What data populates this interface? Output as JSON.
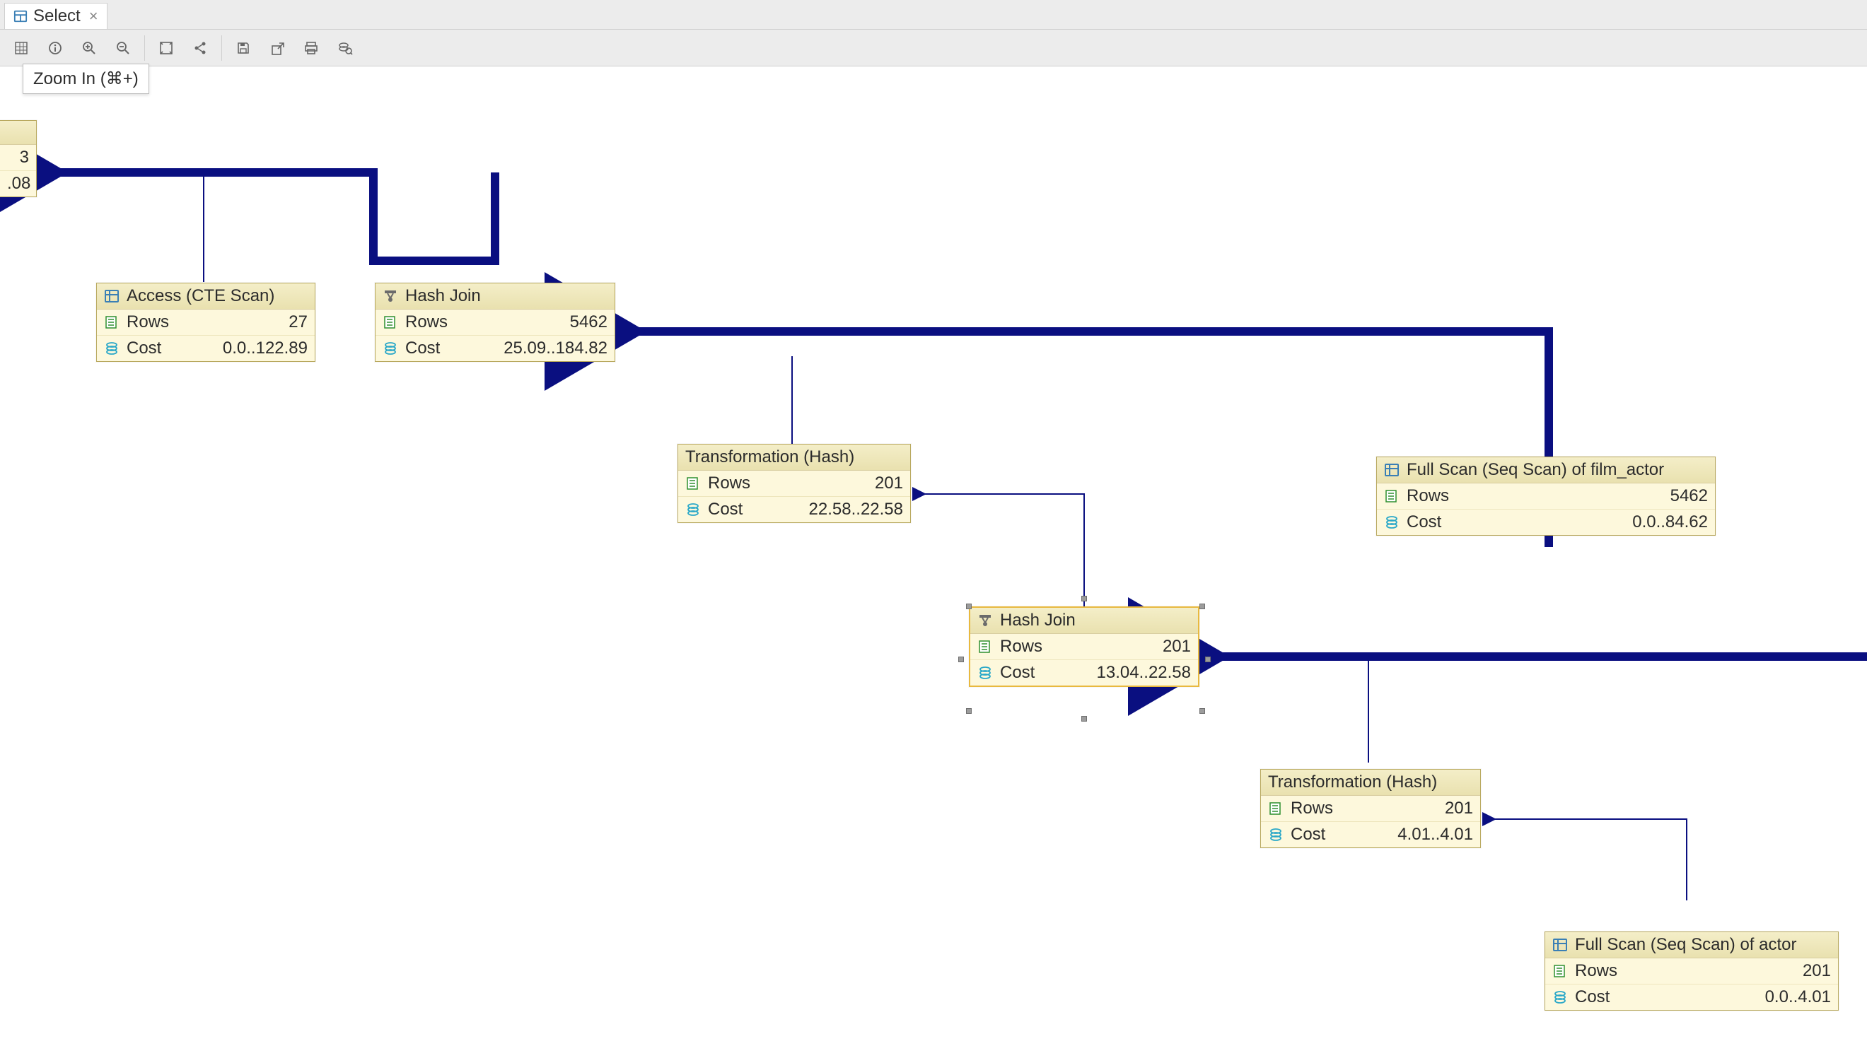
{
  "tab": {
    "label": "Select"
  },
  "tooltip": {
    "text": "Zoom In (⌘+)"
  },
  "toolbar_icons": [
    "grid-icon",
    "info-icon",
    "zoom-in-icon",
    "zoom-out-icon",
    "fit-to-screen-icon",
    "share-icon",
    "save-icon",
    "export-icon",
    "print-icon",
    "inspect-icon"
  ],
  "nodes": {
    "result_partial": {
      "rows": "3",
      "cost": ".08"
    },
    "access_cte": {
      "title": "Access (CTE Scan)",
      "rows_label": "Rows",
      "rows": "27",
      "cost_label": "Cost",
      "cost": "0.0..122.89"
    },
    "hash_join_1": {
      "title": "Hash Join",
      "rows_label": "Rows",
      "rows": "5462",
      "cost_label": "Cost",
      "cost": "25.09..184.82"
    },
    "transform_hash_1": {
      "title": "Transformation (Hash)",
      "rows_label": "Rows",
      "rows": "201",
      "cost_label": "Cost",
      "cost": "22.58..22.58"
    },
    "full_scan_film_actor": {
      "title": "Full Scan (Seq Scan) of film_actor",
      "rows_label": "Rows",
      "rows": "5462",
      "cost_label": "Cost",
      "cost": "0.0..84.62"
    },
    "hash_join_2": {
      "title": "Hash Join",
      "rows_label": "Rows",
      "rows": "201",
      "cost_label": "Cost",
      "cost": "13.04..22.58"
    },
    "transform_hash_2": {
      "title": "Transformation (Hash)",
      "rows_label": "Rows",
      "rows": "201",
      "cost_label": "Cost",
      "cost": "4.01..4.01"
    },
    "full_scan_actor": {
      "title": "Full Scan (Seq Scan) of actor",
      "rows_label": "Rows",
      "rows": "201",
      "cost_label": "Cost",
      "cost": "0.0..4.01"
    }
  }
}
